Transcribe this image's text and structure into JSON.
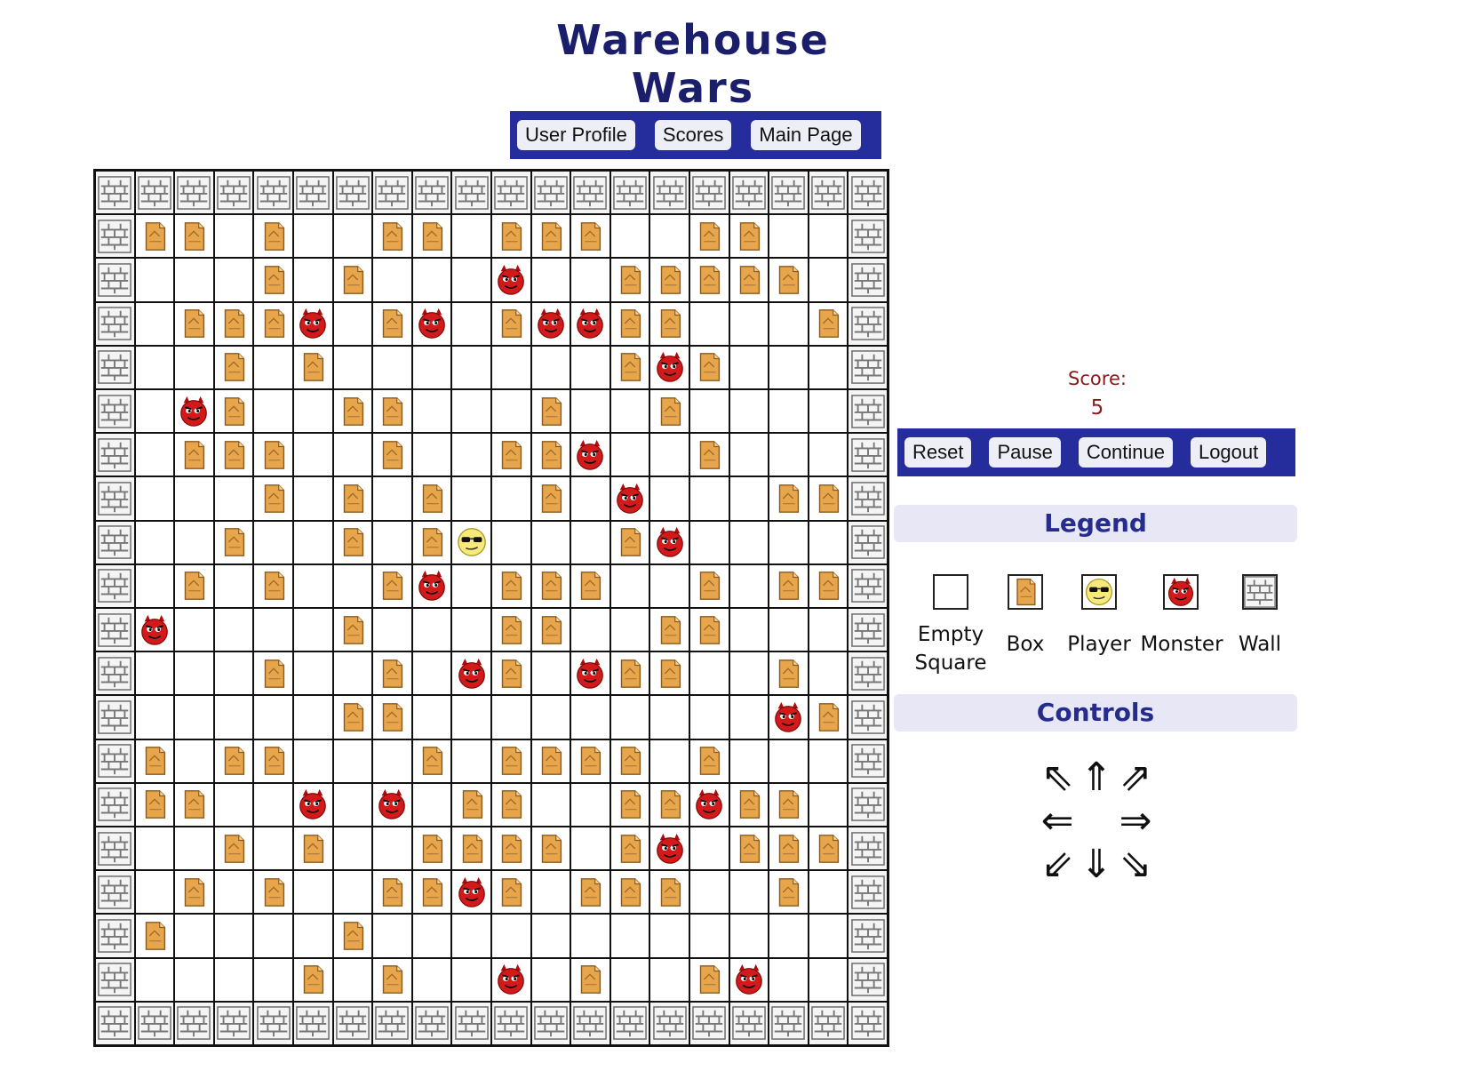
{
  "title": "Warehouse Wars",
  "nav": {
    "user_profile": "User Profile",
    "scores": "Scores",
    "main_page": "Main Page"
  },
  "score": {
    "label": "Score:",
    "value": "5"
  },
  "game_controls": {
    "reset": "Reset",
    "pause": "Pause",
    "continue": "Continue",
    "logout": "Logout"
  },
  "legend": {
    "heading": "Legend",
    "items": [
      {
        "icon": "empty-square",
        "label_line1": "Empty",
        "label_line2": "Square"
      },
      {
        "icon": "box",
        "label_line1": "Box",
        "label_line2": ""
      },
      {
        "icon": "player",
        "label_line1": "Player",
        "label_line2": ""
      },
      {
        "icon": "monster",
        "label_line1": "Monster",
        "label_line2": ""
      },
      {
        "icon": "wall",
        "label_line1": "Wall",
        "label_line2": ""
      }
    ]
  },
  "controls": {
    "heading": "Controls",
    "arrows": {
      "nw": "⇖",
      "n": "⇑",
      "ne": "⇗",
      "w": "⇐",
      "e": "⇒",
      "sw": "⇙",
      "s": "⇓",
      "se": "⇘"
    }
  },
  "board": {
    "legend_codes": {
      "W": "wall",
      "B": "box",
      "M": "monster",
      "P": "player",
      ".": "empty"
    },
    "rows": [
      "WWWWWWWWWWWWWWWWWWWW",
      "WBB.B..BB.BBB..BB..W",
      "W...B.B...M..BBBBB.W",
      "W.BBBM.BM.BMMBB...BW",
      "W..B.B.......BMB...W",
      "W.MB..BB...B..B....W",
      "W.BBB..B..BBM..B...W",
      "W...B.B.B..B.M...BBW",
      "W..B..B.BP...BM....W",
      "W.B.B..BM.BBB..B.BBW",
      "WM....B...BB..BB...W",
      "W...B..B.MB.MBB..B.W",
      "W.....BB.........MBW",
      "WB.BB...B.BBBB.B...W",
      "WBB..M.M.BB..BBMBB.W",
      "W..B.B..BBBB.BM.BBBW",
      "W.B.B..BBMB.BBB..B.W",
      "WB....B............W",
      "W....B.B..M.B..BM..W",
      "WWWWWWWWWWWWWWWWWWWW"
    ]
  },
  "colors": {
    "nav_bar": "#252c9c",
    "title": "#1b1f6b",
    "score": "#8b1a1a",
    "section_bg": "#e7e7f6",
    "section_text": "#252c8c"
  }
}
